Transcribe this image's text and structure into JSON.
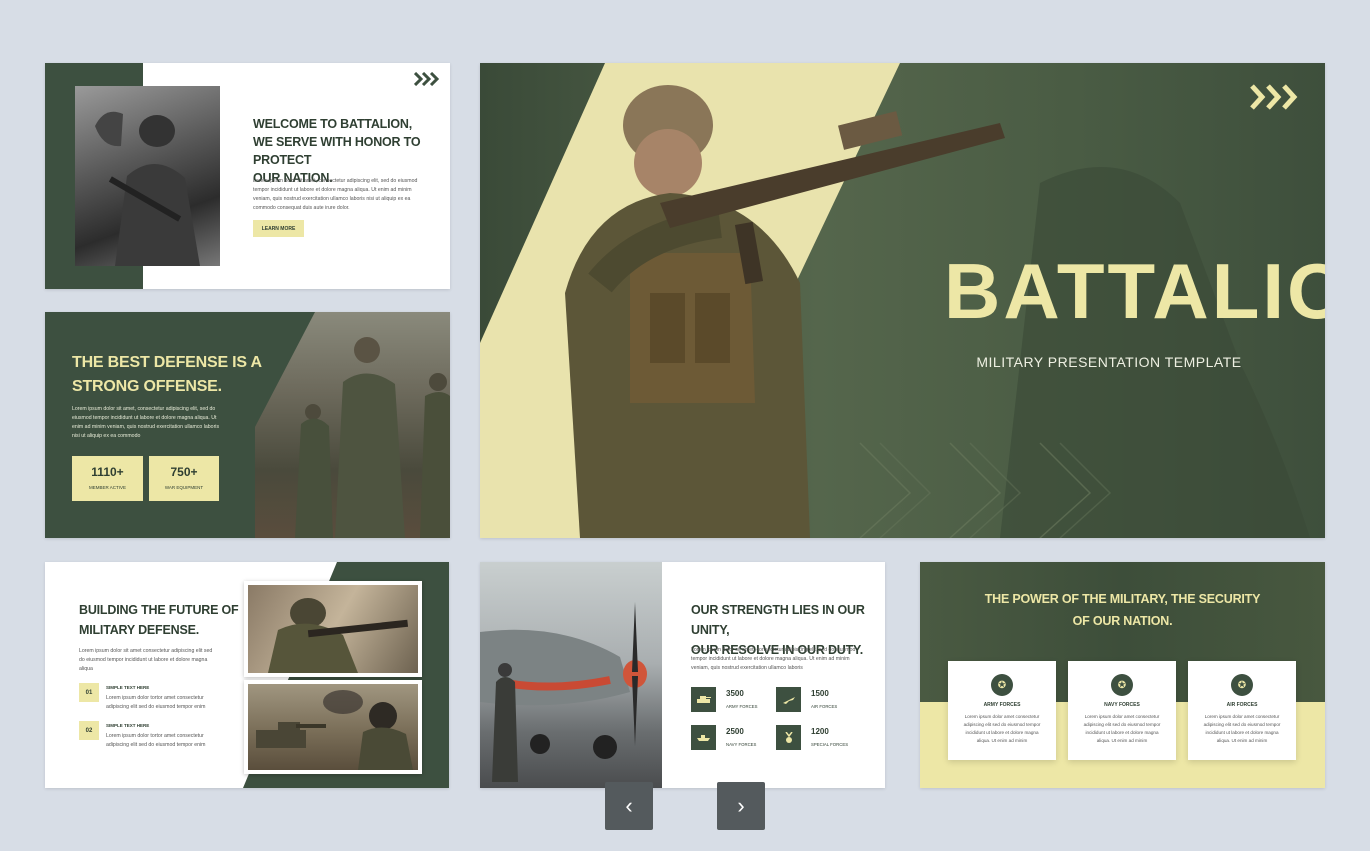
{
  "slide1": {
    "heading": [
      "WELCOME TO BATTALION,",
      "WE SERVE WITH HONOR TO PROTECT",
      "OUR NATION."
    ],
    "body": "Lorem ipsum dolor sit amet, consectetur adipiscing elit, sed do eiusmod tempor incididunt ut labore et dolore magna aliqua. Ut enim ad minim veniam, quis nostrud exercitation ullamco laboris nisi ut aliquip ex ea commodo consequat duis aute irure dolor.",
    "button": "LEARN MORE"
  },
  "slide2": {
    "heading": [
      "THE BEST DEFENSE IS A",
      "STRONG OFFENSE."
    ],
    "body": "Lorem ipsum dolor sit amet, consectetur adipiscing elit, sed do eiusmod tempor incididunt ut labore et dolore magna aliqua. Ut enim ad minim veniam, quis nostrud exercitation ullamco laboris nisi ut aliquip ex ea commodo",
    "stats": [
      {
        "value": "1110+",
        "label": "MEMBER ACTIVE"
      },
      {
        "value": "750+",
        "label": "WAR EQUIPMENT"
      }
    ]
  },
  "hero": {
    "title": "BATTALION",
    "subtitle": "MILITARY PRESENTATION TEMPLATE"
  },
  "slide4": {
    "heading": [
      "BUILDING THE FUTURE OF",
      "MILITARY DEFENSE."
    ],
    "body": "Lorem ipsum dolor sit amet consectetur adipiscing elit sed do eiusmod tempor incididunt ut labore et dolore magna aliqua",
    "items": [
      {
        "num": "01",
        "title": "SIMPLE TEXT HERE",
        "text": "Lorem ipsum dolor tortor amet consectetur adipiscing elit sed do eiusmod tempor enim"
      },
      {
        "num": "02",
        "title": "SIMPLE TEXT HERE",
        "text": "Lorem ipsum dolor tortor amet consectetur adipiscing elit sed do eiusmod tempor enim"
      }
    ]
  },
  "slide5": {
    "heading": [
      "OUR STRENGTH LIES IN OUR UNITY,",
      "OUR RESOLVE IN OUR DUTY."
    ],
    "body": "Lorem ipsum dolor sit amet, consectetur adipiscing elit, sed do eiusmod tempor incididunt ut labore et dolore magna aliqua. Ut enim ad minim veniam, quis nostrud exercitation ullamco laboris",
    "stats": [
      {
        "value": "3500",
        "label": "ARMY FORCES",
        "icon": "tank-icon"
      },
      {
        "value": "1500",
        "label": "AIR FORCES",
        "icon": "jet-icon"
      },
      {
        "value": "2500",
        "label": "NAVY FORCES",
        "icon": "ship-icon"
      },
      {
        "value": "1200",
        "label": "SPECIAL FORCES",
        "icon": "medal-icon"
      }
    ]
  },
  "slide6": {
    "heading": [
      "THE POWER OF THE MILITARY, THE SECURITY",
      "OF OUR NATION."
    ],
    "cards": [
      {
        "title": "ARMY FORCES",
        "text": "Lorem ipsum dolor amet consectetur adipiscing elit sed do eiusmod tempor incididunt ut labore et dolore magna aliqua. Ut enim ad minim"
      },
      {
        "title": "NAVY FORCES",
        "text": "Lorem ipsum dolor amet consectetur adipiscing elit sed do eiusmod tempor incididunt ut labore et dolore magna aliqua. Ut enim ad minim"
      },
      {
        "title": "AIR FORCES",
        "text": "Lorem ipsum dolor amet consectetur adipiscing elit sed do eiusmod tempor incididunt ut labore et dolore magna aliqua. Ut enim ad minim"
      }
    ]
  },
  "nav": {
    "prev": "‹",
    "next": "›"
  },
  "colors": {
    "green": "#3d5040",
    "cream": "#ede7a6",
    "background": "#d7dde6"
  }
}
